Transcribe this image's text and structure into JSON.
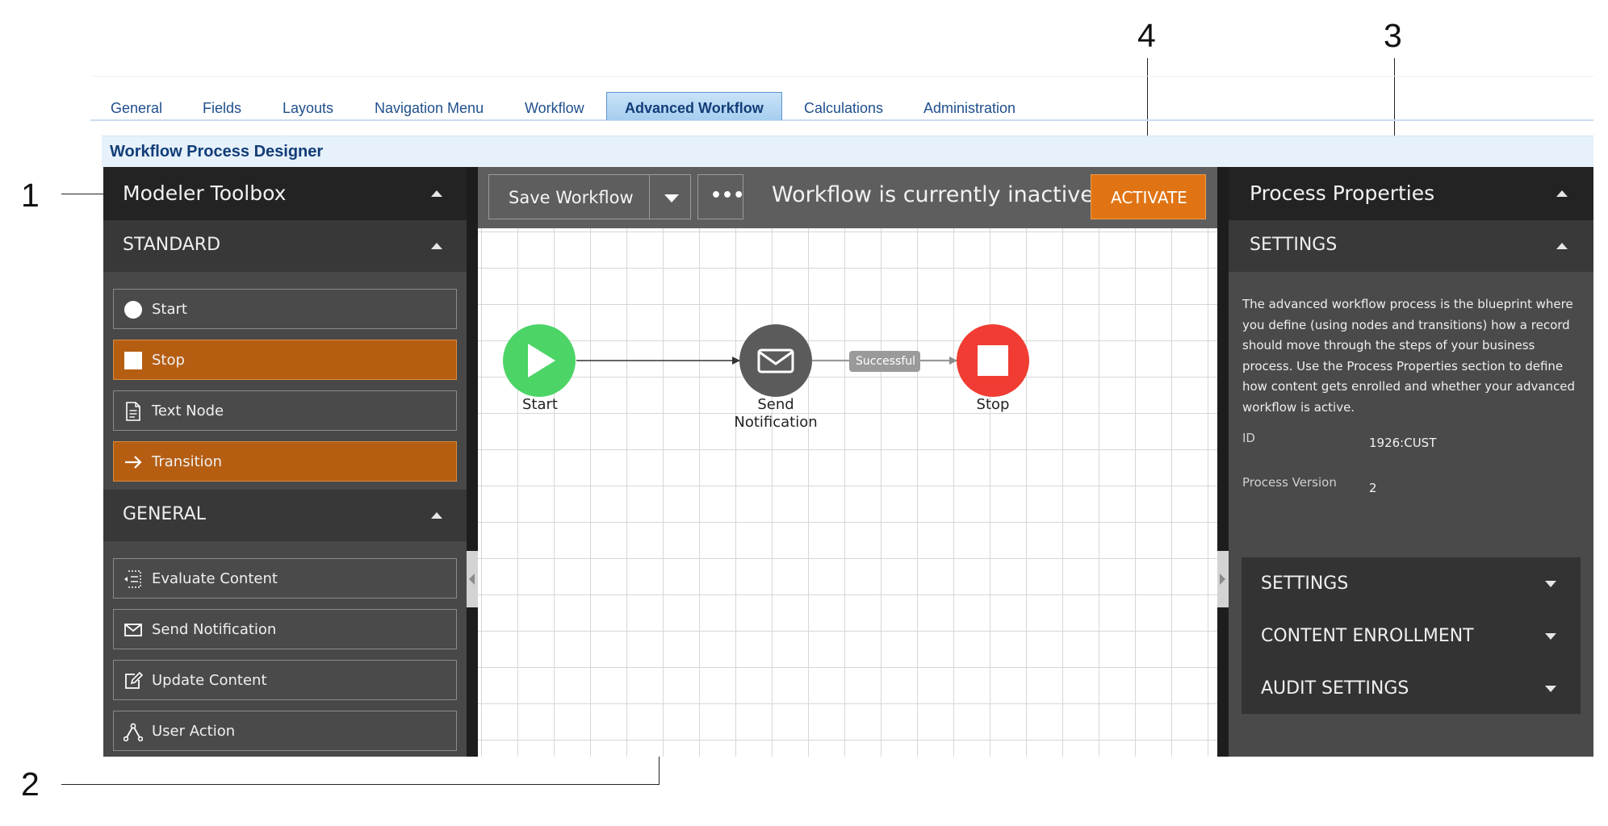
{
  "callouts": {
    "one": "1",
    "two": "2",
    "three": "3",
    "four": "4"
  },
  "tabs": [
    {
      "label": "General"
    },
    {
      "label": "Fields"
    },
    {
      "label": "Layouts"
    },
    {
      "label": "Navigation Menu"
    },
    {
      "label": "Workflow"
    },
    {
      "label": "Advanced Workflow",
      "active": true
    },
    {
      "label": "Calculations"
    },
    {
      "label": "Administration"
    }
  ],
  "designer": {
    "title": "Workflow Process Designer"
  },
  "toolbox": {
    "title": "Modeler Toolbox",
    "standard": {
      "title": "STANDARD",
      "items": [
        {
          "label": "Start",
          "icon": "circle-icon"
        },
        {
          "label": "Stop",
          "icon": "square-icon"
        },
        {
          "label": "Text Node",
          "icon": "document-icon"
        },
        {
          "label": "Transition",
          "icon": "arrow-right-icon"
        }
      ]
    },
    "general": {
      "title": "GENERAL",
      "items": [
        {
          "label": "Evaluate Content",
          "icon": "evaluate-icon"
        },
        {
          "label": "Send Notification",
          "icon": "envelope-icon"
        },
        {
          "label": "Update Content",
          "icon": "edit-icon"
        },
        {
          "label": "User Action",
          "icon": "user-action-icon"
        }
      ]
    }
  },
  "canvas": {
    "save_label": "Save Workflow",
    "more_label": "•••",
    "status": "Workflow is currently inactive.",
    "activate_label": "ACTIVATE",
    "nodes": {
      "start": "Start",
      "send_line1": "Send",
      "send_line2": "Notification",
      "stop": "Stop"
    },
    "transition_label": "Successful"
  },
  "properties": {
    "title": "Process Properties",
    "settings_title": "SETTINGS",
    "description": "The advanced workflow process is the blueprint where you define (using nodes and transitions) how a record should move through the steps of your business process. Use the Process Properties section to define how content gets enrolled and whether your advanced workflow is active.",
    "id_label": "ID",
    "id_value": "1926:CUST",
    "version_label": "Process Version",
    "version_value": "2",
    "accordion": [
      {
        "label": "SETTINGS"
      },
      {
        "label": "CONTENT ENROLLMENT"
      },
      {
        "label": "AUDIT SETTINGS"
      }
    ]
  },
  "colors": {
    "accent_orange": "#b55e12",
    "activate_orange": "#e07414",
    "start_green": "#4cd467",
    "stop_red": "#f03c32",
    "node_gray": "#5b5b5b"
  }
}
